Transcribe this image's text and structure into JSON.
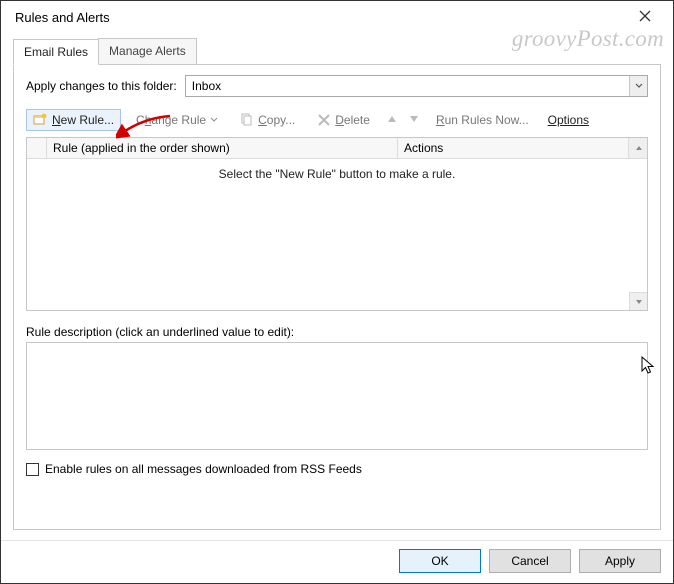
{
  "window": {
    "title": "Rules and Alerts"
  },
  "watermark": "groovyPost.com",
  "tabs": [
    {
      "label": "Email Rules",
      "active": true
    },
    {
      "label": "Manage Alerts",
      "active": false
    }
  ],
  "folderRow": {
    "label": "Apply changes to this folder:",
    "value": "Inbox"
  },
  "toolbar": {
    "newRule": "New Rule...",
    "changeRule": "Change Rule",
    "copy": "Copy...",
    "del": "Delete",
    "runNow": "Run Rules Now...",
    "options": "Options"
  },
  "grid": {
    "col_rule": "Rule (applied in the order shown)",
    "col_actions": "Actions",
    "empty": "Select the \"New Rule\" button to make a rule."
  },
  "description": {
    "label": "Rule description (click an underlined value to edit):"
  },
  "rss": {
    "label": "Enable rules on all messages downloaded from RSS Feeds"
  },
  "footer": {
    "ok": "OK",
    "cancel": "Cancel",
    "apply": "Apply"
  }
}
